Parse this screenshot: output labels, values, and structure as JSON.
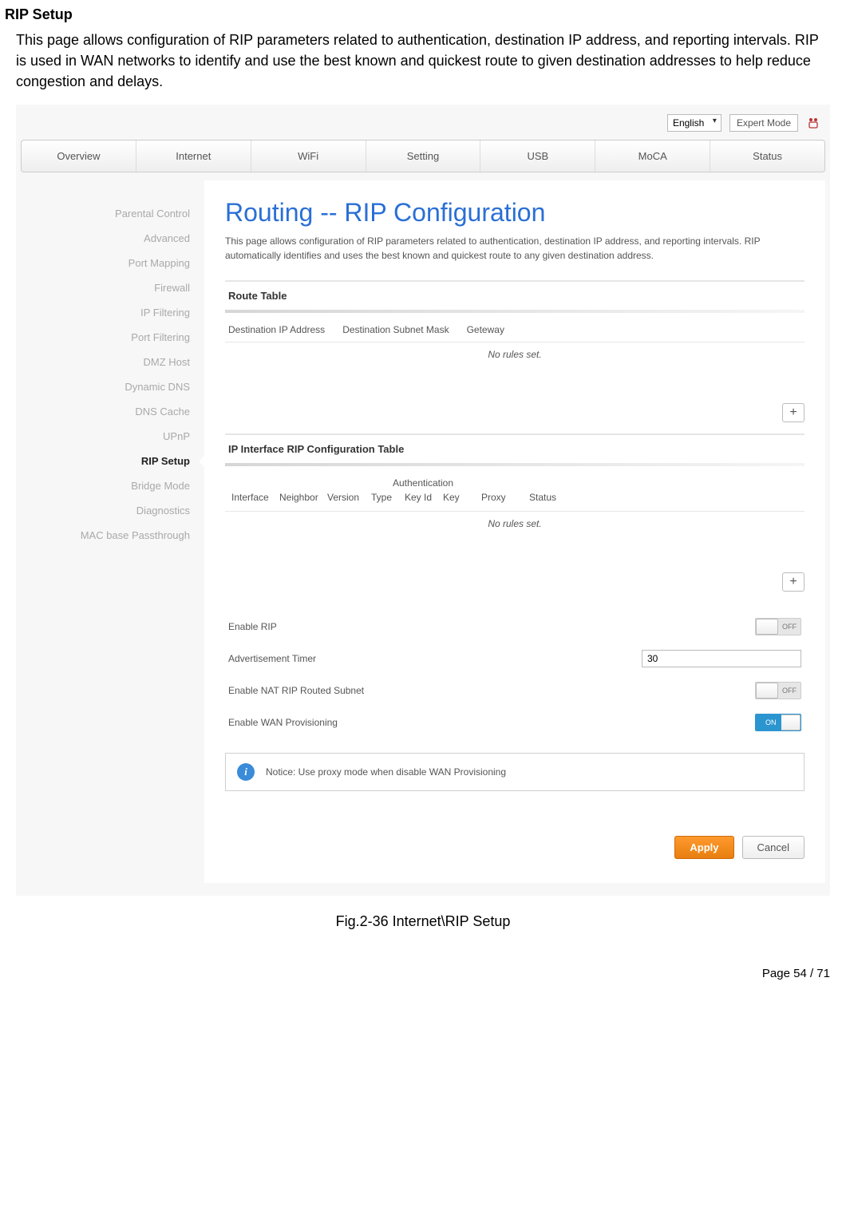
{
  "doc": {
    "heading": "RIP Setup",
    "intro": "This page allows configuration of RIP parameters related to authentication, destination IP address, and reporting intervals. RIP is used in WAN networks to identify and use the best known and quickest route to given destination addresses to help reduce congestion and delays.",
    "caption": "Fig.2-36 Internet\\RIP Setup",
    "footer": "Page 54 / 71"
  },
  "topbar": {
    "language": "English",
    "expert_mode": "Expert Mode"
  },
  "tabs": [
    "Overview",
    "Internet",
    "WiFi",
    "Setting",
    "USB",
    "MoCA",
    "Status"
  ],
  "sidebar": {
    "items": [
      "Parental Control",
      "Advanced",
      "Port Mapping",
      "Firewall",
      "IP Filtering",
      "Port Filtering",
      "DMZ Host",
      "Dynamic DNS",
      "DNS Cache",
      "UPnP",
      "RIP Setup",
      "Bridge Mode",
      "Diagnostics",
      "MAC base Passthrough"
    ],
    "active_index": 10
  },
  "content": {
    "title": "Routing -- RIP Configuration",
    "description": "This page allows configuration of RIP parameters related to authentication, destination IP address, and reporting intervals. RIP automatically identifies and uses the best known and quickest route to any given destination address.",
    "route_table": {
      "title": "Route Table",
      "cols": [
        "Destination IP Address",
        "Destination Subnet Mask",
        "Geteway"
      ],
      "empty": "No rules set."
    },
    "rip_table": {
      "title": "IP Interface RIP Configuration Table",
      "auth_header": "Authentication",
      "cols": [
        "Interface",
        "Neighbor",
        "Version",
        "Type",
        "Key Id",
        "Key",
        "Proxy",
        "Status"
      ],
      "empty": "No rules set."
    },
    "settings": {
      "enable_rip": {
        "label": "Enable RIP",
        "state": "OFF"
      },
      "adv_timer": {
        "label": "Advertisement Timer",
        "value": "30"
      },
      "enable_nat": {
        "label": "Enable NAT RIP Routed Subnet",
        "state": "OFF"
      },
      "enable_wan": {
        "label": "Enable WAN Provisioning",
        "state": "ON"
      }
    },
    "notice": "Notice: Use proxy mode when disable WAN Provisioning",
    "apply": "Apply",
    "cancel": "Cancel",
    "add": "+"
  }
}
